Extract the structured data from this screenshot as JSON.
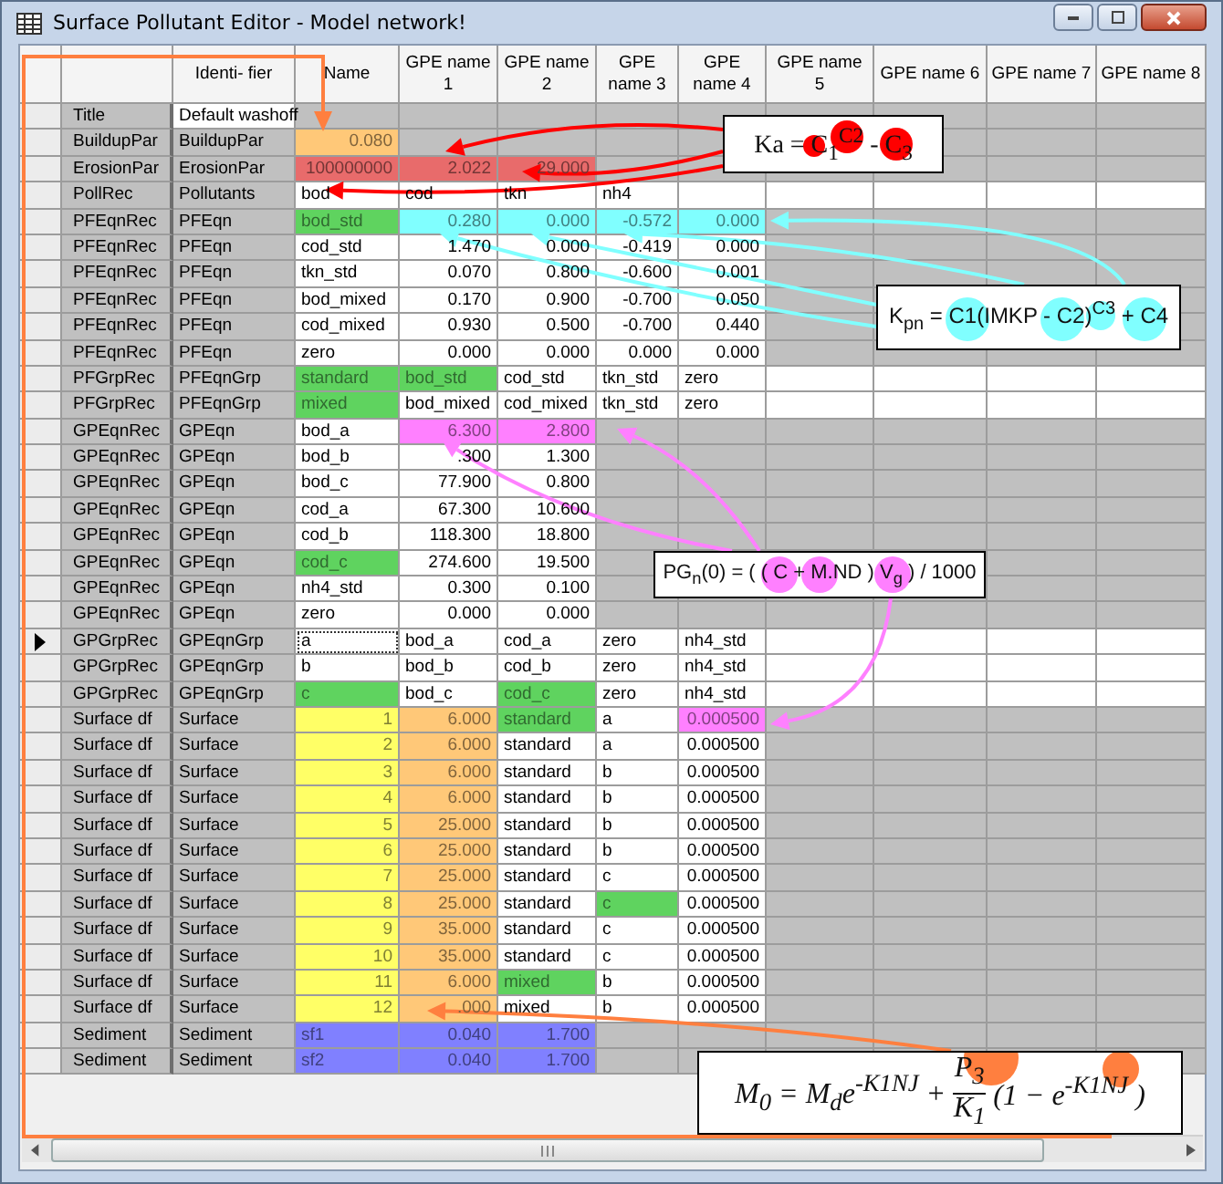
{
  "window": {
    "title": "Surface Pollutant Editor - Model network!"
  },
  "columns": [
    "Identi- fier",
    "Name",
    "GPE name 1",
    "GPE name 2",
    "GPE name 3",
    "GPE name 4",
    "GPE name 5",
    "GPE name 6",
    "GPE name 7",
    "GPE name 8"
  ],
  "rows": [
    {
      "record": "Title",
      "identifier": {
        "text": "Default washoff",
        "color": "#ffffff"
      },
      "blank": {
        "color": "#c0c0c0"
      },
      "current": false
    },
    {
      "record": "BuildupPar",
      "identifier": {
        "text": "BuildupPar",
        "color": "#c0c0c0"
      },
      "blank": {
        "color": "#c0c0c0"
      },
      "current": false,
      "cells": [
        {
          "text": "0.080",
          "kind": "num",
          "color": "#ffc878"
        }
      ]
    },
    {
      "record": "ErosionPar",
      "identifier": {
        "text": "ErosionPar",
        "color": "#c0c0c0"
      },
      "blank": {
        "color": "#c0c0c0"
      },
      "current": false,
      "cells": [
        {
          "text": "100000000",
          "kind": "num",
          "color": "#e86b6b"
        },
        {
          "text": "2.022",
          "kind": "num",
          "color": "#e86b6b"
        },
        {
          "text": "29.000",
          "kind": "num",
          "color": "#e86b6b"
        }
      ]
    },
    {
      "record": "PollRec",
      "identifier": {
        "text": "Pollutants",
        "color": "#c0c0c0"
      },
      "blank": {
        "color": "#ffffff"
      },
      "current": false,
      "cells": [
        {
          "text": "bod",
          "kind": "text",
          "color": "#ffffff"
        },
        {
          "text": "cod",
          "kind": "text",
          "color": "#ffffff"
        },
        {
          "text": "tkn",
          "kind": "text",
          "color": "#ffffff"
        },
        {
          "text": "nh4",
          "kind": "text",
          "color": "#ffffff"
        }
      ]
    },
    {
      "record": "PFEqnRec",
      "identifier": {
        "text": "PFEqn",
        "color": "#c0c0c0"
      },
      "blank": {
        "color": "#c0c0c0"
      },
      "current": false,
      "cells": [
        {
          "text": "bod_std",
          "kind": "text",
          "color": "#5fd35f"
        },
        {
          "text": "0.280",
          "kind": "num",
          "color": "#80ffff"
        },
        {
          "text": "0.000",
          "kind": "num",
          "color": "#80ffff"
        },
        {
          "text": "-0.572",
          "kind": "num",
          "color": "#80ffff"
        },
        {
          "text": "0.000",
          "kind": "num",
          "color": "#80ffff"
        }
      ]
    },
    {
      "record": "PFEqnRec",
      "identifier": {
        "text": "PFEqn",
        "color": "#c0c0c0"
      },
      "blank": {
        "color": "#c0c0c0"
      },
      "current": false,
      "cells": [
        {
          "text": "cod_std",
          "kind": "text",
          "color": "#ffffff"
        },
        {
          "text": "1.470",
          "kind": "num",
          "color": "#ffffff"
        },
        {
          "text": "0.000",
          "kind": "num",
          "color": "#ffffff"
        },
        {
          "text": "-0.419",
          "kind": "num",
          "color": "#ffffff"
        },
        {
          "text": "0.000",
          "kind": "num",
          "color": "#ffffff"
        }
      ]
    },
    {
      "record": "PFEqnRec",
      "identifier": {
        "text": "PFEqn",
        "color": "#c0c0c0"
      },
      "blank": {
        "color": "#c0c0c0"
      },
      "current": false,
      "cells": [
        {
          "text": "tkn_std",
          "kind": "text",
          "color": "#ffffff"
        },
        {
          "text": "0.070",
          "kind": "num",
          "color": "#ffffff"
        },
        {
          "text": "0.800",
          "kind": "num",
          "color": "#ffffff"
        },
        {
          "text": "-0.600",
          "kind": "num",
          "color": "#ffffff"
        },
        {
          "text": "0.001",
          "kind": "num",
          "color": "#ffffff"
        }
      ]
    },
    {
      "record": "PFEqnRec",
      "identifier": {
        "text": "PFEqn",
        "color": "#c0c0c0"
      },
      "blank": {
        "color": "#c0c0c0"
      },
      "current": false,
      "cells": [
        {
          "text": "bod_mixed",
          "kind": "text",
          "color": "#ffffff"
        },
        {
          "text": "0.170",
          "kind": "num",
          "color": "#ffffff"
        },
        {
          "text": "0.900",
          "kind": "num",
          "color": "#ffffff"
        },
        {
          "text": "-0.700",
          "kind": "num",
          "color": "#ffffff"
        },
        {
          "text": "0.050",
          "kind": "num",
          "color": "#ffffff"
        }
      ]
    },
    {
      "record": "PFEqnRec",
      "identifier": {
        "text": "PFEqn",
        "color": "#c0c0c0"
      },
      "blank": {
        "color": "#c0c0c0"
      },
      "current": false,
      "cells": [
        {
          "text": "cod_mixed",
          "kind": "text",
          "color": "#ffffff"
        },
        {
          "text": "0.930",
          "kind": "num",
          "color": "#ffffff"
        },
        {
          "text": "0.500",
          "kind": "num",
          "color": "#ffffff"
        },
        {
          "text": "-0.700",
          "kind": "num",
          "color": "#ffffff"
        },
        {
          "text": "0.440",
          "kind": "num",
          "color": "#ffffff"
        }
      ]
    },
    {
      "record": "PFEqnRec",
      "identifier": {
        "text": "PFEqn",
        "color": "#c0c0c0"
      },
      "blank": {
        "color": "#c0c0c0"
      },
      "current": false,
      "cells": [
        {
          "text": "zero",
          "kind": "text",
          "color": "#ffffff"
        },
        {
          "text": "0.000",
          "kind": "num",
          "color": "#ffffff"
        },
        {
          "text": "0.000",
          "kind": "num",
          "color": "#ffffff"
        },
        {
          "text": "0.000",
          "kind": "num",
          "color": "#ffffff"
        },
        {
          "text": "0.000",
          "kind": "num",
          "color": "#ffffff"
        }
      ]
    },
    {
      "record": "PFGrpRec",
      "identifier": {
        "text": "PFEqnGrp",
        "color": "#c0c0c0"
      },
      "blank": {
        "color": "#ffffff"
      },
      "current": false,
      "cells": [
        {
          "text": "standard",
          "kind": "text",
          "color": "#5fd35f"
        },
        {
          "text": "bod_std",
          "kind": "text",
          "color": "#5fd35f"
        },
        {
          "text": "cod_std",
          "kind": "text",
          "color": "#ffffff"
        },
        {
          "text": "tkn_std",
          "kind": "text",
          "color": "#ffffff"
        },
        {
          "text": "zero",
          "kind": "text",
          "color": "#ffffff"
        }
      ]
    },
    {
      "record": "PFGrpRec",
      "identifier": {
        "text": "PFEqnGrp",
        "color": "#c0c0c0"
      },
      "blank": {
        "color": "#ffffff"
      },
      "current": false,
      "cells": [
        {
          "text": "mixed",
          "kind": "text",
          "color": "#5fd35f"
        },
        {
          "text": "bod_mixed",
          "kind": "text",
          "color": "#ffffff"
        },
        {
          "text": "cod_mixed",
          "kind": "text",
          "color": "#ffffff"
        },
        {
          "text": "tkn_std",
          "kind": "text",
          "color": "#ffffff"
        },
        {
          "text": "zero",
          "kind": "text",
          "color": "#ffffff"
        }
      ]
    },
    {
      "record": "GPEqnRec",
      "identifier": {
        "text": "GPEqn",
        "color": "#c0c0c0"
      },
      "blank": {
        "color": "#c0c0c0"
      },
      "current": false,
      "cells": [
        {
          "text": "bod_a",
          "kind": "text",
          "color": "#ffffff"
        },
        {
          "text": "6.300",
          "kind": "num",
          "color": "#ff80ff"
        },
        {
          "text": "2.800",
          "kind": "num",
          "color": "#ff80ff"
        }
      ]
    },
    {
      "record": "GPEqnRec",
      "identifier": {
        "text": "GPEqn",
        "color": "#c0c0c0"
      },
      "blank": {
        "color": "#c0c0c0"
      },
      "current": false,
      "cells": [
        {
          "text": "bod_b",
          "kind": "text",
          "color": "#ffffff"
        },
        {
          "text": ".300",
          "kind": "num",
          "color": "#ffffff"
        },
        {
          "text": "1.300",
          "kind": "num",
          "color": "#ffffff"
        }
      ]
    },
    {
      "record": "GPEqnRec",
      "identifier": {
        "text": "GPEqn",
        "color": "#c0c0c0"
      },
      "blank": {
        "color": "#c0c0c0"
      },
      "current": false,
      "cells": [
        {
          "text": "bod_c",
          "kind": "text",
          "color": "#ffffff"
        },
        {
          "text": "77.900",
          "kind": "num",
          "color": "#ffffff"
        },
        {
          "text": "0.800",
          "kind": "num",
          "color": "#ffffff"
        }
      ]
    },
    {
      "record": "GPEqnRec",
      "identifier": {
        "text": "GPEqn",
        "color": "#c0c0c0"
      },
      "blank": {
        "color": "#c0c0c0"
      },
      "current": false,
      "cells": [
        {
          "text": "cod_a",
          "kind": "text",
          "color": "#ffffff"
        },
        {
          "text": "67.300",
          "kind": "num",
          "color": "#ffffff"
        },
        {
          "text": "10.600",
          "kind": "num",
          "color": "#ffffff"
        }
      ]
    },
    {
      "record": "GPEqnRec",
      "identifier": {
        "text": "GPEqn",
        "color": "#c0c0c0"
      },
      "blank": {
        "color": "#c0c0c0"
      },
      "current": false,
      "cells": [
        {
          "text": "cod_b",
          "kind": "text",
          "color": "#ffffff"
        },
        {
          "text": "118.300",
          "kind": "num",
          "color": "#ffffff"
        },
        {
          "text": "18.800",
          "kind": "num",
          "color": "#ffffff"
        }
      ]
    },
    {
      "record": "GPEqnRec",
      "identifier": {
        "text": "GPEqn",
        "color": "#c0c0c0"
      },
      "blank": {
        "color": "#c0c0c0"
      },
      "current": false,
      "cells": [
        {
          "text": "cod_c",
          "kind": "text",
          "color": "#5fd35f"
        },
        {
          "text": "274.600",
          "kind": "num",
          "color": "#ffffff"
        },
        {
          "text": "19.500",
          "kind": "num",
          "color": "#ffffff"
        }
      ]
    },
    {
      "record": "GPEqnRec",
      "identifier": {
        "text": "GPEqn",
        "color": "#c0c0c0"
      },
      "blank": {
        "color": "#c0c0c0"
      },
      "current": false,
      "cells": [
        {
          "text": "nh4_std",
          "kind": "text",
          "color": "#ffffff"
        },
        {
          "text": "0.300",
          "kind": "num",
          "color": "#ffffff"
        },
        {
          "text": "0.100",
          "kind": "num",
          "color": "#ffffff"
        }
      ]
    },
    {
      "record": "GPEqnRec",
      "identifier": {
        "text": "GPEqn",
        "color": "#c0c0c0"
      },
      "blank": {
        "color": "#c0c0c0"
      },
      "current": false,
      "cells": [
        {
          "text": "zero",
          "kind": "text",
          "color": "#ffffff"
        },
        {
          "text": "0.000",
          "kind": "num",
          "color": "#ffffff"
        },
        {
          "text": "0.000",
          "kind": "num",
          "color": "#ffffff"
        }
      ]
    },
    {
      "record": "GPGrpRec",
      "identifier": {
        "text": "GPEqnGrp",
        "color": "#c0c0c0"
      },
      "blank": {
        "color": "#ffffff"
      },
      "current": true,
      "cells": [
        {
          "text": "a",
          "kind": "text",
          "color": "#ffffff"
        },
        {
          "text": "bod_a",
          "kind": "text",
          "color": "#ffffff"
        },
        {
          "text": "cod_a",
          "kind": "text",
          "color": "#ffffff"
        },
        {
          "text": "zero",
          "kind": "text",
          "color": "#ffffff"
        },
        {
          "text": "nh4_std",
          "kind": "text",
          "color": "#ffffff"
        }
      ]
    },
    {
      "record": "GPGrpRec",
      "identifier": {
        "text": "GPEqnGrp",
        "color": "#c0c0c0"
      },
      "blank": {
        "color": "#ffffff"
      },
      "current": false,
      "cells": [
        {
          "text": "b",
          "kind": "text",
          "color": "#ffffff"
        },
        {
          "text": "bod_b",
          "kind": "text",
          "color": "#ffffff"
        },
        {
          "text": "cod_b",
          "kind": "text",
          "color": "#ffffff"
        },
        {
          "text": "zero",
          "kind": "text",
          "color": "#ffffff"
        },
        {
          "text": "nh4_std",
          "kind": "text",
          "color": "#ffffff"
        }
      ]
    },
    {
      "record": "GPGrpRec",
      "identifier": {
        "text": "GPEqnGrp",
        "color": "#c0c0c0"
      },
      "blank": {
        "color": "#ffffff"
      },
      "current": false,
      "cells": [
        {
          "text": "c",
          "kind": "text",
          "color": "#5fd35f"
        },
        {
          "text": "bod_c",
          "kind": "text",
          "color": "#ffffff"
        },
        {
          "text": "cod_c",
          "kind": "text",
          "color": "#5fd35f"
        },
        {
          "text": "zero",
          "kind": "text",
          "color": "#ffffff"
        },
        {
          "text": "nh4_std",
          "kind": "text",
          "color": "#ffffff"
        }
      ]
    },
    {
      "record": "Surface df",
      "identifier": {
        "text": "Surface",
        "color": "#c0c0c0"
      },
      "blank": {
        "color": "#c0c0c0"
      },
      "current": false,
      "cells": [
        {
          "text": "1",
          "kind": "num",
          "color": "#ffff66"
        },
        {
          "text": "6.000",
          "kind": "num",
          "color": "#ffc878"
        },
        {
          "text": "standard",
          "kind": "text",
          "color": "#5fd35f"
        },
        {
          "text": "a",
          "kind": "text",
          "color": "#ffffff"
        },
        {
          "text": "0.000500",
          "kind": "num",
          "color": "#ff80ff"
        }
      ]
    },
    {
      "record": "Surface df",
      "identifier": {
        "text": "Surface",
        "color": "#c0c0c0"
      },
      "blank": {
        "color": "#c0c0c0"
      },
      "current": false,
      "cells": [
        {
          "text": "2",
          "kind": "num",
          "color": "#ffff66"
        },
        {
          "text": "6.000",
          "kind": "num",
          "color": "#ffc878"
        },
        {
          "text": "standard",
          "kind": "text",
          "color": "#ffffff"
        },
        {
          "text": "a",
          "kind": "text",
          "color": "#ffffff"
        },
        {
          "text": "0.000500",
          "kind": "num",
          "color": "#ffffff"
        }
      ]
    },
    {
      "record": "Surface df",
      "identifier": {
        "text": "Surface",
        "color": "#c0c0c0"
      },
      "blank": {
        "color": "#c0c0c0"
      },
      "current": false,
      "cells": [
        {
          "text": "3",
          "kind": "num",
          "color": "#ffff66"
        },
        {
          "text": "6.000",
          "kind": "num",
          "color": "#ffc878"
        },
        {
          "text": "standard",
          "kind": "text",
          "color": "#ffffff"
        },
        {
          "text": "b",
          "kind": "text",
          "color": "#ffffff"
        },
        {
          "text": "0.000500",
          "kind": "num",
          "color": "#ffffff"
        }
      ]
    },
    {
      "record": "Surface df",
      "identifier": {
        "text": "Surface",
        "color": "#c0c0c0"
      },
      "blank": {
        "color": "#c0c0c0"
      },
      "current": false,
      "cells": [
        {
          "text": "4",
          "kind": "num",
          "color": "#ffff66"
        },
        {
          "text": "6.000",
          "kind": "num",
          "color": "#ffc878"
        },
        {
          "text": "standard",
          "kind": "text",
          "color": "#ffffff"
        },
        {
          "text": "b",
          "kind": "text",
          "color": "#ffffff"
        },
        {
          "text": "0.000500",
          "kind": "num",
          "color": "#ffffff"
        }
      ]
    },
    {
      "record": "Surface df",
      "identifier": {
        "text": "Surface",
        "color": "#c0c0c0"
      },
      "blank": {
        "color": "#c0c0c0"
      },
      "current": false,
      "cells": [
        {
          "text": "5",
          "kind": "num",
          "color": "#ffff66"
        },
        {
          "text": "25.000",
          "kind": "num",
          "color": "#ffc878"
        },
        {
          "text": "standard",
          "kind": "text",
          "color": "#ffffff"
        },
        {
          "text": "b",
          "kind": "text",
          "color": "#ffffff"
        },
        {
          "text": "0.000500",
          "kind": "num",
          "color": "#ffffff"
        }
      ]
    },
    {
      "record": "Surface df",
      "identifier": {
        "text": "Surface",
        "color": "#c0c0c0"
      },
      "blank": {
        "color": "#c0c0c0"
      },
      "current": false,
      "cells": [
        {
          "text": "6",
          "kind": "num",
          "color": "#ffff66"
        },
        {
          "text": "25.000",
          "kind": "num",
          "color": "#ffc878"
        },
        {
          "text": "standard",
          "kind": "text",
          "color": "#ffffff"
        },
        {
          "text": "b",
          "kind": "text",
          "color": "#ffffff"
        },
        {
          "text": "0.000500",
          "kind": "num",
          "color": "#ffffff"
        }
      ]
    },
    {
      "record": "Surface df",
      "identifier": {
        "text": "Surface",
        "color": "#c0c0c0"
      },
      "blank": {
        "color": "#c0c0c0"
      },
      "current": false,
      "cells": [
        {
          "text": "7",
          "kind": "num",
          "color": "#ffff66"
        },
        {
          "text": "25.000",
          "kind": "num",
          "color": "#ffc878"
        },
        {
          "text": "standard",
          "kind": "text",
          "color": "#ffffff"
        },
        {
          "text": "c",
          "kind": "text",
          "color": "#ffffff"
        },
        {
          "text": "0.000500",
          "kind": "num",
          "color": "#ffffff"
        }
      ]
    },
    {
      "record": "Surface df",
      "identifier": {
        "text": "Surface",
        "color": "#c0c0c0"
      },
      "blank": {
        "color": "#c0c0c0"
      },
      "current": false,
      "cells": [
        {
          "text": "8",
          "kind": "num",
          "color": "#ffff66"
        },
        {
          "text": "25.000",
          "kind": "num",
          "color": "#ffc878"
        },
        {
          "text": "standard",
          "kind": "text",
          "color": "#ffffff"
        },
        {
          "text": "c",
          "kind": "text",
          "color": "#5fd35f"
        },
        {
          "text": "0.000500",
          "kind": "num",
          "color": "#ffffff"
        }
      ]
    },
    {
      "record": "Surface df",
      "identifier": {
        "text": "Surface",
        "color": "#c0c0c0"
      },
      "blank": {
        "color": "#c0c0c0"
      },
      "current": false,
      "cells": [
        {
          "text": "9",
          "kind": "num",
          "color": "#ffff66"
        },
        {
          "text": "35.000",
          "kind": "num",
          "color": "#ffc878"
        },
        {
          "text": "standard",
          "kind": "text",
          "color": "#ffffff"
        },
        {
          "text": "c",
          "kind": "text",
          "color": "#ffffff"
        },
        {
          "text": "0.000500",
          "kind": "num",
          "color": "#ffffff"
        }
      ]
    },
    {
      "record": "Surface df",
      "identifier": {
        "text": "Surface",
        "color": "#c0c0c0"
      },
      "blank": {
        "color": "#c0c0c0"
      },
      "current": false,
      "cells": [
        {
          "text": "10",
          "kind": "num",
          "color": "#ffff66"
        },
        {
          "text": "35.000",
          "kind": "num",
          "color": "#ffc878"
        },
        {
          "text": "standard",
          "kind": "text",
          "color": "#ffffff"
        },
        {
          "text": "c",
          "kind": "text",
          "color": "#ffffff"
        },
        {
          "text": "0.000500",
          "kind": "num",
          "color": "#ffffff"
        }
      ]
    },
    {
      "record": "Surface df",
      "identifier": {
        "text": "Surface",
        "color": "#c0c0c0"
      },
      "blank": {
        "color": "#c0c0c0"
      },
      "current": false,
      "cells": [
        {
          "text": "11",
          "kind": "num",
          "color": "#ffff66"
        },
        {
          "text": "6.000",
          "kind": "num",
          "color": "#ffc878"
        },
        {
          "text": "mixed",
          "kind": "text",
          "color": "#5fd35f"
        },
        {
          "text": "b",
          "kind": "text",
          "color": "#ffffff"
        },
        {
          "text": "0.000500",
          "kind": "num",
          "color": "#ffffff"
        }
      ]
    },
    {
      "record": "Surface df",
      "identifier": {
        "text": "Surface",
        "color": "#c0c0c0"
      },
      "blank": {
        "color": "#c0c0c0"
      },
      "current": false,
      "cells": [
        {
          "text": "12",
          "kind": "num",
          "color": "#ffff66"
        },
        {
          "text": ".000",
          "kind": "num",
          "color": "#ffc878"
        },
        {
          "text": "mixed",
          "kind": "text",
          "color": "#ffffff"
        },
        {
          "text": "b",
          "kind": "text",
          "color": "#ffffff"
        },
        {
          "text": "0.000500",
          "kind": "num",
          "color": "#ffffff"
        }
      ]
    },
    {
      "record": "Sediment",
      "identifier": {
        "text": "Sediment",
        "color": "#c0c0c0"
      },
      "blank": {
        "color": "#c0c0c0"
      },
      "current": false,
      "cells": [
        {
          "text": "sf1",
          "kind": "text",
          "color": "#8080ff"
        },
        {
          "text": "0.040",
          "kind": "num",
          "color": "#8080ff"
        },
        {
          "text": "1.700",
          "kind": "num",
          "color": "#8080ff"
        }
      ]
    },
    {
      "record": "Sediment",
      "identifier": {
        "text": "Sediment",
        "color": "#c0c0c0"
      },
      "blank": {
        "color": "#c0c0c0"
      },
      "current": false,
      "cells": [
        {
          "text": "sf2",
          "kind": "text",
          "color": "#8080ff"
        },
        {
          "text": "0.040",
          "kind": "num",
          "color": "#8080ff"
        },
        {
          "text": "1.700",
          "kind": "num",
          "color": "#8080ff"
        }
      ]
    }
  ],
  "annotations": [
    {
      "kind": "inline",
      "text": "Ka = C$_{1}$$^{C2}$ - C$_{3}$",
      "color": "#ff0000"
    },
    {
      "kind": "inline",
      "text": "K$_{pn}$ = C1(IMKP - C2)$^{C3}$ + C4",
      "color": "#80ffff"
    },
    {
      "kind": "inline",
      "text": "PG$_{n}$(0) = ( ( C + M.ND ) V$_{g}$ ) / 1000",
      "color": "#ff80ff"
    },
    {
      "kind": "fraction",
      "lead": "M$_{0}$ = M$_{d}$e$^{-K1NJ}$ +",
      "numerator": "P$_{3}$",
      "denominator": "K$_{1}$",
      "tail": "(1 − e$^{-K1NJ}$ )",
      "color": "#ff7f3f"
    }
  ]
}
